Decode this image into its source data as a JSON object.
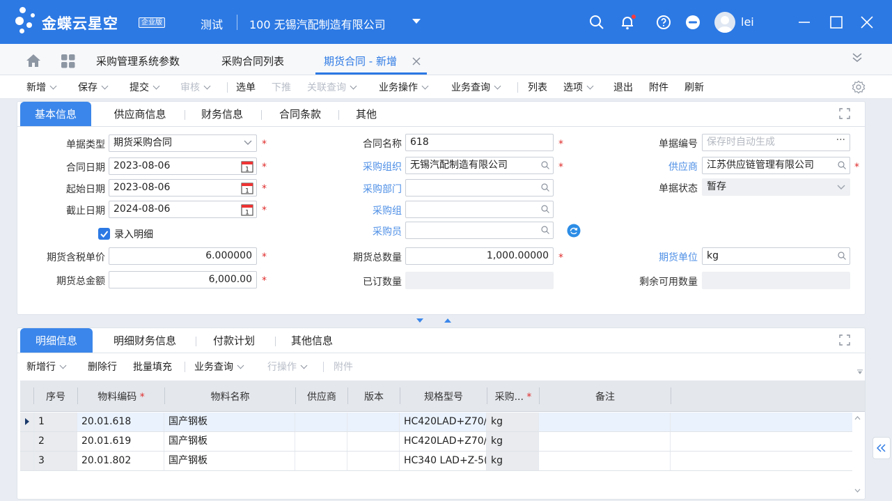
{
  "header": {
    "brand": "金蝶云星空",
    "edition": "企业版",
    "test": "测试",
    "org": "100  无锡汽配制造有限公司",
    "user": "lei",
    "brand_color": "#2c79e4"
  },
  "nav": {
    "tabs": [
      {
        "label": "采购管理系统参数"
      },
      {
        "label": "采购合同列表"
      },
      {
        "label": "期货合同 - 新增"
      }
    ]
  },
  "toolbar": {
    "items": [
      "新增",
      "保存",
      "提交",
      "审核",
      "选单",
      "下推",
      "关联查询",
      "业务操作",
      "业务查询",
      "列表",
      "选项",
      "退出",
      "附件",
      "刷新"
    ]
  },
  "form_tabs": [
    "基本信息",
    "供应商信息",
    "财务信息",
    "合同条款",
    "其他"
  ],
  "form": {
    "bill_type": {
      "label": "单据类型",
      "value": "期货采购合同"
    },
    "contract_date": {
      "label": "合同日期",
      "value": "2023-08-06"
    },
    "start_date": {
      "label": "起始日期",
      "value": "2023-08-06"
    },
    "end_date": {
      "label": "截止日期",
      "value": "2024-08-06"
    },
    "detail_entry": {
      "label": "录入明细",
      "checked": true
    },
    "unit_price": {
      "label": "期货含税单价",
      "value": "6.000000"
    },
    "total_amount": {
      "label": "期货总金额",
      "value": "6,000.00"
    },
    "contract_name": {
      "label": "合同名称",
      "value": "618"
    },
    "purchase_org": {
      "label": "采购组织",
      "value": "无锡汽配制造有限公司"
    },
    "purchase_dept": {
      "label": "采购部门",
      "value": ""
    },
    "purchase_group": {
      "label": "采购组",
      "value": ""
    },
    "purchaser": {
      "label": "采购员",
      "value": ""
    },
    "total_qty": {
      "label": "期货总数量",
      "value": "1,000.00000"
    },
    "ordered_qty": {
      "label": "已订数量",
      "value": ""
    },
    "bill_no": {
      "label": "单据编号",
      "placeholder": "保存时自动生成"
    },
    "supplier": {
      "label": "供应商",
      "value": "江苏供应链管理有限公司"
    },
    "bill_status": {
      "label": "单据状态",
      "value": "暂存"
    },
    "futures_unit": {
      "label": "期货单位",
      "value": "kg"
    },
    "remaining_qty": {
      "label": "剩余可用数量",
      "value": ""
    }
  },
  "detail_tabs": [
    "明细信息",
    "明细财务信息",
    "付款计划",
    "其他信息"
  ],
  "detail_toolbar": [
    "新增行",
    "删除行",
    "批量填充",
    "业务查询",
    "行操作",
    "附件"
  ],
  "grid": {
    "columns": [
      "序号",
      "物料编码",
      "物料名称",
      "供应商",
      "版本",
      "规格型号",
      "采购...",
      "备注"
    ],
    "rows": [
      {
        "seq": "1",
        "code": "20.01.618",
        "name": "国产钢板",
        "supplier": "",
        "version": "",
        "spec": "HC420LAD+Z70/",
        "unit": "kg",
        "note": ""
      },
      {
        "seq": "2",
        "code": "20.01.619",
        "name": "国产钢板",
        "supplier": "",
        "version": "",
        "spec": "HC420LAD+Z70/",
        "unit": "kg",
        "note": ""
      },
      {
        "seq": "3",
        "code": "20.01.802",
        "name": "国产钢板",
        "supplier": "",
        "version": "",
        "spec": "HC340 LAD+Z-5(",
        "unit": "kg",
        "note": ""
      }
    ]
  }
}
